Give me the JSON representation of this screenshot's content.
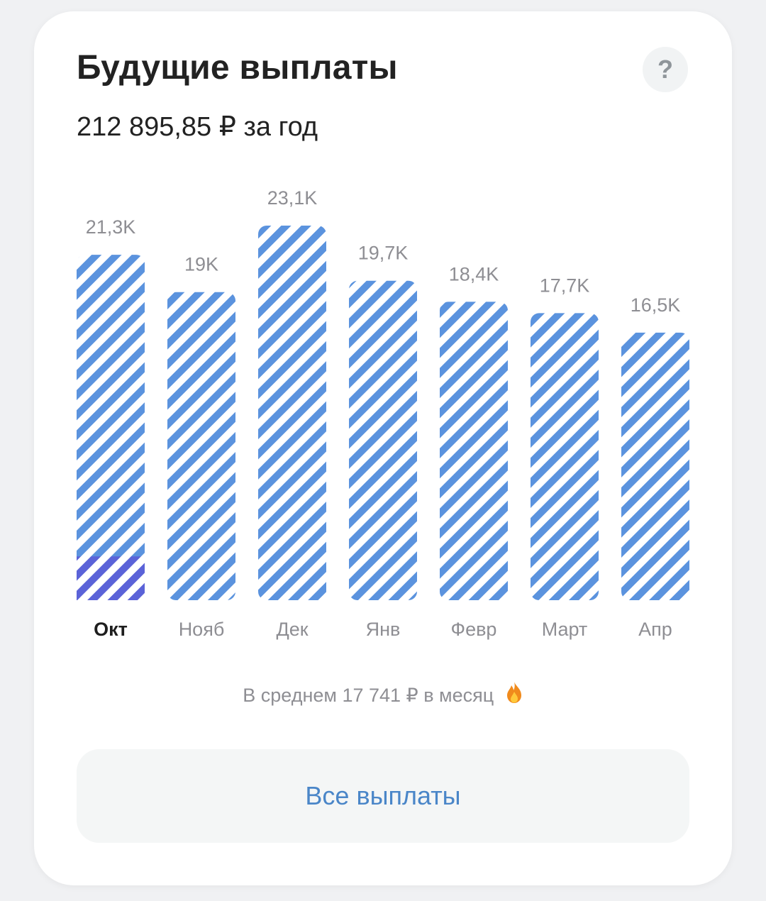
{
  "card": {
    "title": "Будущие выплаты",
    "subtitle": "212 895,85 ₽ за год",
    "help_label": "?",
    "help_icon": "question-icon",
    "average_text": "В среднем 17 741 ₽ в месяц",
    "average_icon": "fire-icon",
    "all_button_label": "Все выплаты"
  },
  "colors": {
    "stripe": "#5b93de",
    "stripe_paid": "#5b63d8",
    "button_text": "#4a86c8"
  },
  "chart_data": {
    "type": "bar",
    "categories": [
      "Окт",
      "Нояб",
      "Дек",
      "Янв",
      "Февр",
      "Март",
      "Апр"
    ],
    "values": [
      21.3,
      19.0,
      23.1,
      19.7,
      18.4,
      17.7,
      16.5
    ],
    "value_labels": [
      "21,3K",
      "19K",
      "23,1K",
      "19,7K",
      "18,4K",
      "17,7K",
      "16,5K"
    ],
    "active_index": 0,
    "paid_values": [
      2.7,
      0,
      0,
      0,
      0,
      0,
      0
    ],
    "pattern": "diagonal-stripes",
    "title": "",
    "xlabel": "",
    "ylabel": "",
    "grid": false,
    "ylim": [
      0,
      23.1
    ]
  }
}
